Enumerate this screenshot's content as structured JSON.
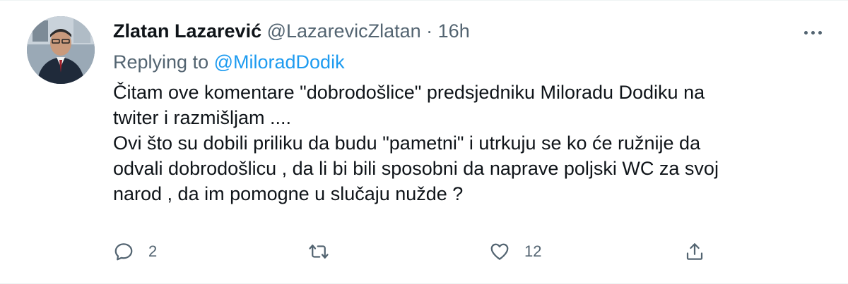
{
  "tweet": {
    "author_name": "Zlatan Lazarević",
    "author_handle": "@LazarevicZlatan",
    "separator": "·",
    "time": "16h",
    "replying_prefix": "Replying to",
    "replying_to": "@MiloradDodik",
    "text_lines": [
      "Čitam ove komentare \"dobrodošlice\" predsjedniku Miloradu Dodiku na",
      "twiter i razmišljam ....",
      "Ovi što su dobili priliku da budu \"pametni\" i utrkuju se ko će ružnije da",
      "odvali dobrodošlicu , da li bi bili sposobni da naprave poljski WC za svoj",
      "narod , da im pomogne u slučaju nužde ?"
    ],
    "reply_count": "2",
    "retweet_count": "",
    "like_count": "12"
  },
  "icons": {
    "more": "more-horizontal-icon",
    "reply": "comment-icon",
    "retweet": "retweet-icon",
    "like": "heart-icon",
    "share": "share-icon"
  },
  "colors": {
    "accent": "#1d9bf0",
    "secondary_text": "#536471",
    "primary_text": "#0f1419"
  }
}
